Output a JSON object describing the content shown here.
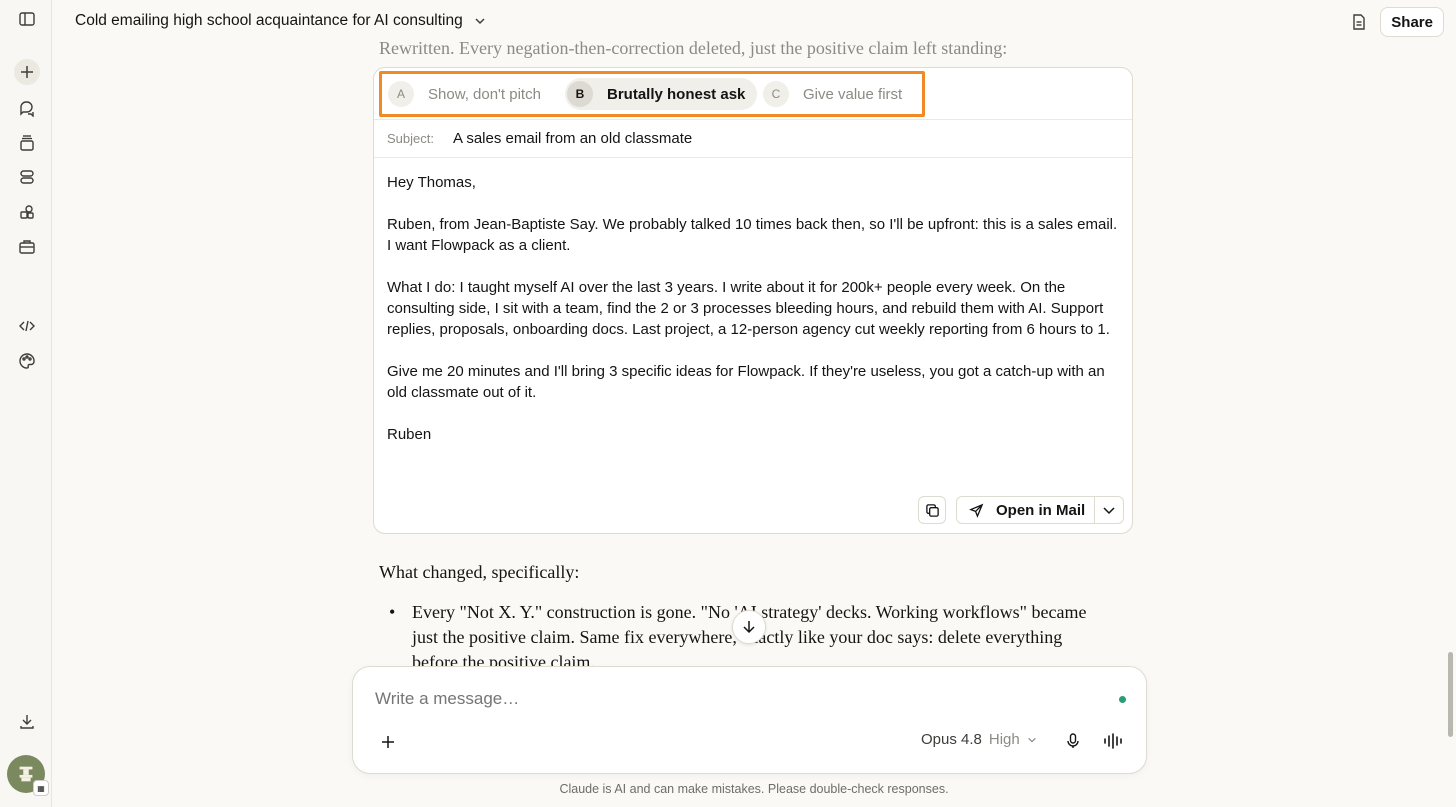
{
  "header": {
    "conversation_title": "Cold emailing high school acquaintance for AI consulting",
    "share_label": "Share"
  },
  "main": {
    "preface_text": "Rewritten. Every negation-then-correction deleted, just the positive claim left standing:",
    "artifact": {
      "tabs": [
        {
          "letter": "A",
          "label": "Show, don't pitch",
          "active": false
        },
        {
          "letter": "B",
          "label": "Brutally honest ask",
          "active": true
        },
        {
          "letter": "C",
          "label": "Give value first",
          "active": false
        }
      ],
      "subject_label": "Subject:",
      "subject_value": "A sales email from an old classmate",
      "body": [
        "Hey Thomas,",
        "Ruben, from Jean-Baptiste Say. We probably talked 10 times back then, so I'll be upfront: this is a sales email. I want Flowpack as a client.",
        "What I do: I taught myself AI over the last 3 years. I write about it for 200k+ people every week. On the consulting side, I sit with a team, find the 2 or 3 processes bleeding hours, and rebuild them with AI. Support replies, proposals, onboarding docs. Last project, a 12-person agency cut weekly reporting from 6 hours to 1.",
        "Give me 20 minutes and I'll bring 3 specific ideas for Flowpack. If they're useless, you got a catch-up with an old classmate out of it.",
        "Ruben"
      ],
      "open_in_mail_label": "Open in Mail"
    },
    "changes_heading": "What changed, specifically:",
    "changes_bullets": [
      "Every \"Not X. Y.\" construction is gone. \"No 'AI strategy' decks. Working workflows\" became just the positive claim. Same fix everywhere, exactly like your doc says: delete everything before the positive claim."
    ]
  },
  "composer": {
    "placeholder": "Write a message…",
    "model_name": "Opus 4.8",
    "effort_level": "High"
  },
  "footer": {
    "disclaimer": "Claude is AI and can make mistakes. Please double-check responses."
  },
  "colors": {
    "accent_outline": "#f08a24",
    "status_dot": "#2a9d76",
    "background": "#faf9f5"
  }
}
